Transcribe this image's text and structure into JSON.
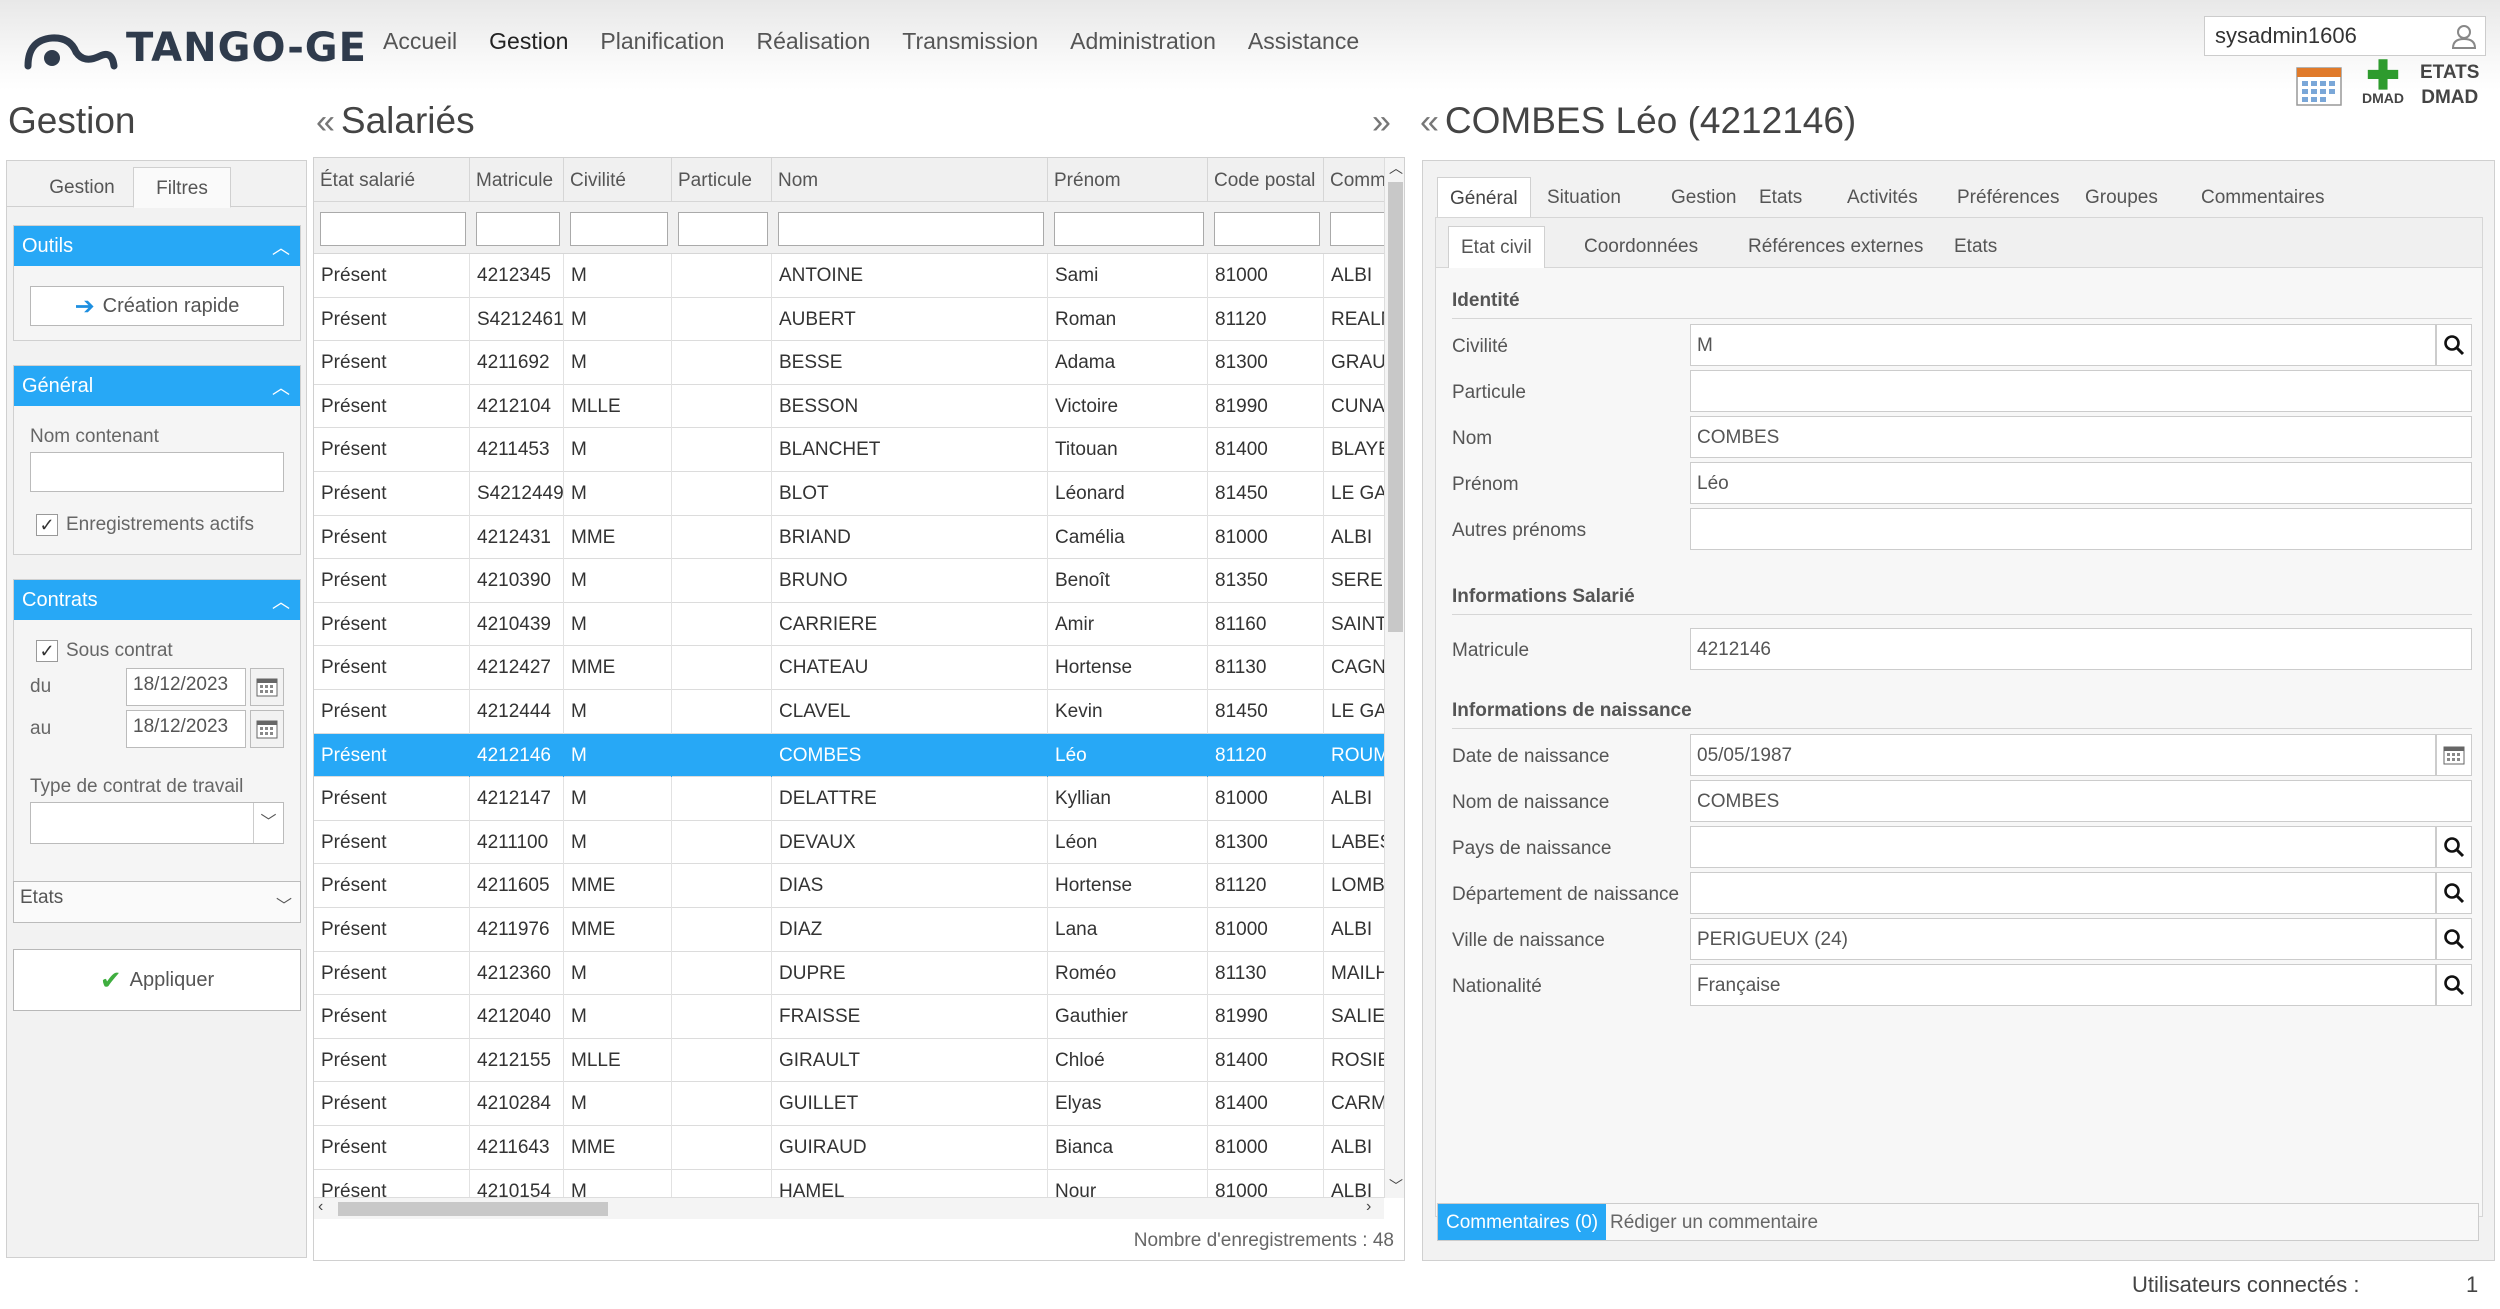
{
  "header": {
    "logo_text": "TANGO-GE",
    "menu": [
      "Accueil",
      "Gestion",
      "Planification",
      "Réalisation",
      "Transmission",
      "Administration",
      "Assistance"
    ],
    "user": "sysadmin1606",
    "dmad_label": "DMAD",
    "etats_label": "ETATS",
    "etats_dmad_label": "DMAD"
  },
  "left": {
    "title": "Gestion",
    "tabs": [
      "Gestion",
      "Filtres"
    ],
    "outils": {
      "title": "Outils",
      "create_button": "Création rapide"
    },
    "general": {
      "title": "Général",
      "name_label": "Nom contenant",
      "name_value": "",
      "active_label": "Enregistrements actifs"
    },
    "contrats": {
      "title": "Contrats",
      "sous_contrat_label": "Sous contrat",
      "du_label": "du",
      "du_value": "18/12/2023",
      "au_label": "au",
      "au_value": "18/12/2023",
      "type_label": "Type de contrat de travail",
      "type_value": ""
    },
    "etats_select": "Etats",
    "apply_button": "Appliquer"
  },
  "middle": {
    "title": "Salariés",
    "columns": [
      "État salarié",
      "Matricule",
      "Civilité",
      "Particule",
      "Nom",
      "Prénom",
      "Code postal",
      "Commune"
    ],
    "rows": [
      [
        "Présent",
        "4212345",
        "M",
        "",
        "ANTOINE",
        "Sami",
        "81000",
        "ALBI"
      ],
      [
        "Présent",
        "S4212461",
        "M",
        "",
        "AUBERT",
        "Roman",
        "81120",
        "REALMONT"
      ],
      [
        "Présent",
        "4211692",
        "M",
        "",
        "BESSE",
        "Adama",
        "81300",
        "GRAULHET"
      ],
      [
        "Présent",
        "4212104",
        "MLLE",
        "",
        "BESSON",
        "Victoire",
        "81990",
        "CUNAC"
      ],
      [
        "Présent",
        "4211453",
        "M",
        "",
        "BLANCHET",
        "Titouan",
        "81400",
        "BLAYE-LES-MINES"
      ],
      [
        "Présent",
        "S4212449",
        "M",
        "",
        "BLOT",
        "Léonard",
        "81450",
        "LE GARRIC"
      ],
      [
        "Présent",
        "4212431",
        "MME",
        "",
        "BRIAND",
        "Camélia",
        "81000",
        "ALBI"
      ],
      [
        "Présent",
        "4210390",
        "M",
        "",
        "BRUNO",
        "Benoît",
        "81350",
        "SERENAC"
      ],
      [
        "Présent",
        "4210439",
        "M",
        "",
        "CARRIERE",
        "Amir",
        "81160",
        "SAINT-JUERY"
      ],
      [
        "Présent",
        "4212427",
        "MME",
        "",
        "CHATEAU",
        "Hortense",
        "81130",
        "CAGNAC"
      ],
      [
        "Présent",
        "4212444",
        "M",
        "",
        "CLAVEL",
        "Kevin",
        "81450",
        "LE GARRIC"
      ],
      [
        "Présent",
        "4212146",
        "M",
        "",
        "COMBES",
        "Léo",
        "81120",
        "ROUMANOU"
      ],
      [
        "Présent",
        "4212147",
        "M",
        "",
        "DELATTRE",
        "Kyllian",
        "81000",
        "ALBI"
      ],
      [
        "Présent",
        "4211100",
        "M",
        "",
        "DEVAUX",
        "Léon",
        "81300",
        "LABESSIERE"
      ],
      [
        "Présent",
        "4211605",
        "MME",
        "",
        "DIAS",
        "Hortense",
        "81120",
        "LOMBERS"
      ],
      [
        "Présent",
        "4211976",
        "MME",
        "",
        "DIAZ",
        "Lana",
        "81000",
        "ALBI"
      ],
      [
        "Présent",
        "4212360",
        "M",
        "",
        "DUPRE",
        "Roméo",
        "81130",
        "MAILHOC"
      ],
      [
        "Présent",
        "4212040",
        "M",
        "",
        "FRAISSE",
        "Gauthier",
        "81990",
        "SALIES"
      ],
      [
        "Présent",
        "4212155",
        "MLLE",
        "",
        "GIRAULT",
        "Chloé",
        "81400",
        "ROSIERES"
      ],
      [
        "Présent",
        "4210284",
        "M",
        "",
        "GUILLET",
        "Elyas",
        "81400",
        "CARMAUX"
      ],
      [
        "Présent",
        "4211643",
        "MME",
        "",
        "GUIRAUD",
        "Bianca",
        "81000",
        "ALBI"
      ],
      [
        "Présent",
        "4210154",
        "M",
        "",
        "HAMEL",
        "Nour",
        "81000",
        "ALBI"
      ]
    ],
    "selected_index": 11,
    "record_count": "Nombre d'enregistrements : 48"
  },
  "detail": {
    "title": "COMBES Léo (4212146)",
    "tabs": [
      "Général",
      "Situation",
      "Gestion",
      "Etats",
      "Activités",
      "Préférences",
      "Groupes",
      "Commentaires"
    ],
    "subtabs": [
      "Etat civil",
      "Coordonnées",
      "Références externes",
      "Etats"
    ],
    "identite_title": "Identité",
    "civilite_label": "Civilité",
    "civilite_value": "M",
    "particule_label": "Particule",
    "particule_value": "",
    "nom_label": "Nom",
    "nom_value": "COMBES",
    "prenom_label": "Prénom",
    "prenom_value": "Léo",
    "autres_label": "Autres prénoms",
    "autres_value": "",
    "salarie_title": "Informations Salarié",
    "matricule_label": "Matricule",
    "matricule_value": "4212146",
    "naissance_title": "Informations de naissance",
    "date_label": "Date de naissance",
    "date_value": "05/05/1987",
    "nom_naissance_label": "Nom de naissance",
    "nom_naissance_value": "COMBES",
    "pays_label": "Pays de naissance",
    "pays_value": "",
    "dept_label": "Département de naissance",
    "dept_value": "",
    "ville_label": "Ville de naissance",
    "ville_value": "PERIGUEUX (24)",
    "nat_label": "Nationalité",
    "nat_value": "Française",
    "comments_button": "Commentaires (0)",
    "comments_link": "Rédiger un commentaire"
  },
  "footer": {
    "connected_label": "Utilisateurs connectés :",
    "connected_count": "1"
  },
  "colors": {
    "accent": "#27a8f6",
    "logo": "#2f3b4c",
    "add_green": "#2e9b2e"
  }
}
